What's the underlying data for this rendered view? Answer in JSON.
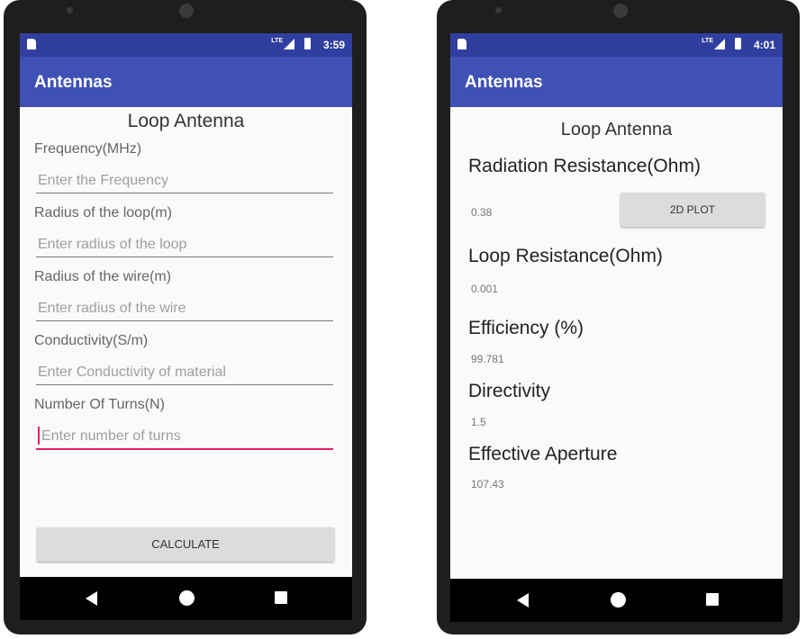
{
  "phone_left": {
    "status_time": "3:59",
    "app_title": "Antennas",
    "heading": "Loop Antenna",
    "fields": [
      {
        "label": "Frequency(MHz)",
        "placeholder": "Enter the Frequency"
      },
      {
        "label": "Radius of the loop(m)",
        "placeholder": "Enter radius of the loop"
      },
      {
        "label": "Radius of the wire(m)",
        "placeholder": "Enter radius of the wire"
      },
      {
        "label": "Conductivity(S/m)",
        "placeholder": "Enter Conductivity of material"
      },
      {
        "label": "Number Of Turns(N)",
        "placeholder": "Enter number of turns"
      }
    ],
    "calculate_label": "CALCULATE"
  },
  "phone_right": {
    "status_time": "4:01",
    "app_title": "Antennas",
    "heading": "Loop Antenna",
    "plot_button_label": "2D PLOT",
    "results": [
      {
        "label": "Radiation Resistance(Ohm)",
        "value": "0.38"
      },
      {
        "label": "Loop Resistance(Ohm)",
        "value": "0.001"
      },
      {
        "label": "Efficiency (%)",
        "value": "99.781"
      },
      {
        "label": "Directivity",
        "value": "1.5"
      },
      {
        "label": "Effective Aperture",
        "value": "107.43"
      }
    ]
  },
  "status_icons": [
    "sim-card-icon",
    "lte-icon",
    "signal-icon",
    "battery-icon"
  ],
  "nav_icons": [
    "back-icon",
    "home-icon",
    "recents-icon"
  ],
  "colors": {
    "primary": "#3f51b5",
    "primary_dark": "#303f9f",
    "accent": "#e91e63",
    "button": "#dcdcdc",
    "screen_bg": "#fafafa"
  }
}
